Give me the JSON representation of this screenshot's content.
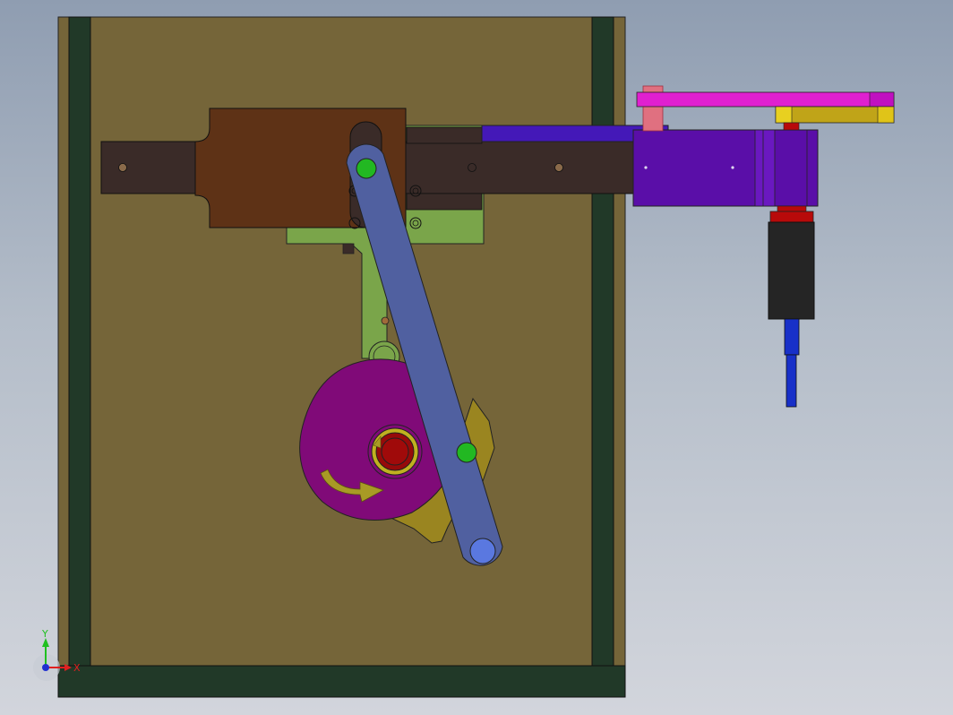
{
  "view": {
    "background_top": "#8f9db1",
    "background_bottom": "#d2d5dc"
  },
  "axes": {
    "x_label": "X",
    "y_label": "Y",
    "x_color": "#e02020",
    "y_color": "#20c020",
    "z_color": "#2030d0"
  },
  "rotation_indicator": {
    "icon": "curved-arrow-icon",
    "color": "#a89a25"
  },
  "colors": {
    "base_plate": "#756539",
    "frame_rail": "#213928",
    "slider_bar": "#3a2b28",
    "slider_block": "#5e3216",
    "green_bracket": "#7aa54a",
    "link_arm": "#5060a0",
    "cam": "#800a78",
    "cam_shaft": "#960a0a",
    "driven_plate": "#9a8520",
    "motor_housing": "#5a0ea8",
    "motor_plate": "#4418b8",
    "pink_lever": "#e020d0",
    "yellow_lever": "#c0a418",
    "red_collar": "#b80a0a",
    "dark_motor_body": "#252525",
    "blue_shaft": "#1830c8",
    "pin_green": "#22b822",
    "pin_blue": "#5a78e0"
  }
}
